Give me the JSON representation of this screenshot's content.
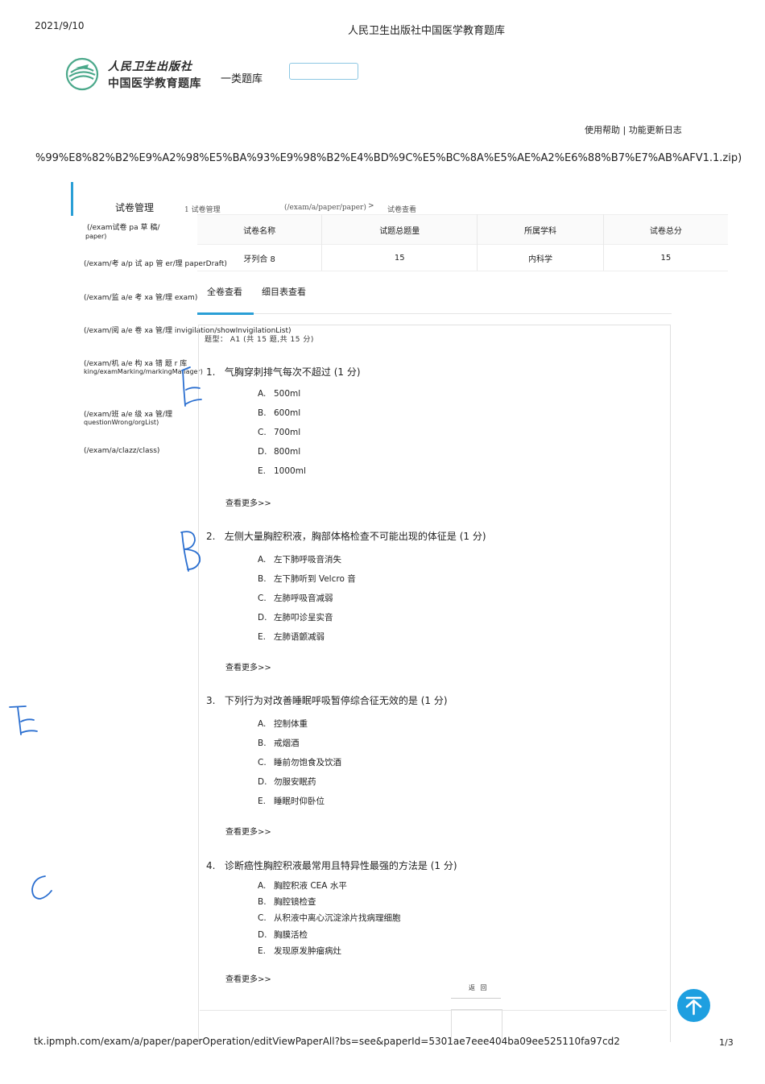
{
  "print": {
    "date": "2021/9/10",
    "title": "人民卫生出版社中国医学教育题库",
    "footer_url": "tk.ipmph.com/exam/a/paper/paperOperation/editViewPaperAll?bs=see&paperId=5301ae7eee404ba09ee525110fa97cd2",
    "page": "1/3"
  },
  "header": {
    "logo_line1": "人民卫生出版社",
    "logo_line2": "中国医学教育题库",
    "category": "一类题库",
    "help_links": "使用帮助 | 功能更新日志",
    "url_fragment": "%99%E8%82%B2%E9%A2%98%E5%BA%93%E9%98%B2%E4%BD%9C%E5%BC%8A%E5%AE%A2%E6%88%B7%E7%AB%AFV1.1.zip)"
  },
  "sidebar": {
    "title": "试卷管理",
    "items": [
      "(/exam试卷 pa 草 稿/",
      "paper)",
      "(/exam/考 a/p 试 ap 管 er/理 paperDraft)",
      "(/exam/监 a/e 考 xa 管/理 exam)",
      "(/exam/阅 a/e 卷 xa 管/理 invigilation/showInvigilationList)",
      "(/exam/机 a/e 构 xa 错 题 r 库",
      "king/examMarking/markingManager)",
      "(/exam/班 a/e 级 xa 管/理",
      "questionWrong/orgList)",
      "(/exam/a/clazz/class)"
    ]
  },
  "breadcrumb": {
    "item1": "1 试卷管理",
    "item1_link": "(/exam/a/paper/paper)",
    "separator": ">",
    "item2": "试卷查看"
  },
  "stats": {
    "headers": [
      "试卷名称",
      "试题总题量",
      "所属学科",
      "试卷总分"
    ],
    "values": [
      "牙列合 8",
      "15",
      "内科学",
      "15"
    ]
  },
  "tabs": {
    "full": "全卷查看",
    "detail": "细目表查看"
  },
  "question_type": "题型： A1 (共 15 题,共 15 分)",
  "more_label": "查看更多>>",
  "questions": [
    {
      "number": "1.",
      "stem": "气胸穿刺排气每次不超过 (1 分)",
      "options": [
        {
          "letter": "A.",
          "text": "500ml"
        },
        {
          "letter": "B.",
          "text": "600ml"
        },
        {
          "letter": "C.",
          "text": "700ml"
        },
        {
          "letter": "D.",
          "text": "800ml"
        },
        {
          "letter": "E.",
          "text": "1000ml"
        }
      ]
    },
    {
      "number": "2.",
      "stem": "左侧大量胸腔积液，胸部体格检查不可能出现的体征是 (1 分)",
      "options": [
        {
          "letter": "A.",
          "text": "左下肺呼吸音消失"
        },
        {
          "letter": "B.",
          "text": "左下肺听到 Velcro 音"
        },
        {
          "letter": "C.",
          "text": "左肺呼吸音减弱"
        },
        {
          "letter": "D.",
          "text": "左肺叩诊呈实音"
        },
        {
          "letter": "E.",
          "text": "左肺语颤减弱"
        }
      ]
    },
    {
      "number": "3.",
      "stem": "下列行为对改善睡眠呼吸暂停综合征无效的是 (1 分)",
      "options": [
        {
          "letter": "A.",
          "text": "控制体重"
        },
        {
          "letter": "B.",
          "text": "戒烟酒"
        },
        {
          "letter": "C.",
          "text": "睡前勿饱食及饮酒"
        },
        {
          "letter": "D.",
          "text": "勿服安眠药"
        },
        {
          "letter": "E.",
          "text": "睡眠时仰卧位"
        }
      ]
    },
    {
      "number": "4.",
      "stem": "诊断癌性胸腔积液最常用且特异性最强的方法是 (1 分)",
      "options": [
        {
          "letter": "A.",
          "text": "胸腔积液 CEA 水平"
        },
        {
          "letter": "B.",
          "text": "胸腔镜检查"
        },
        {
          "letter": "C.",
          "text": "从积液中离心沉淀涂片找病理细胞"
        },
        {
          "letter": "D.",
          "text": "胸膜活检"
        },
        {
          "letter": "E.",
          "text": "发现原发肿瘤病灶"
        }
      ]
    }
  ],
  "return_label": "返 回",
  "colors": {
    "accent": "#2a9fd6",
    "top_button": "#1e9fe0",
    "handwriting": "#2b6fd0"
  },
  "icons": {
    "top": "arrow-up-to-top-icon",
    "logo": "ipmph-logo-icon"
  }
}
